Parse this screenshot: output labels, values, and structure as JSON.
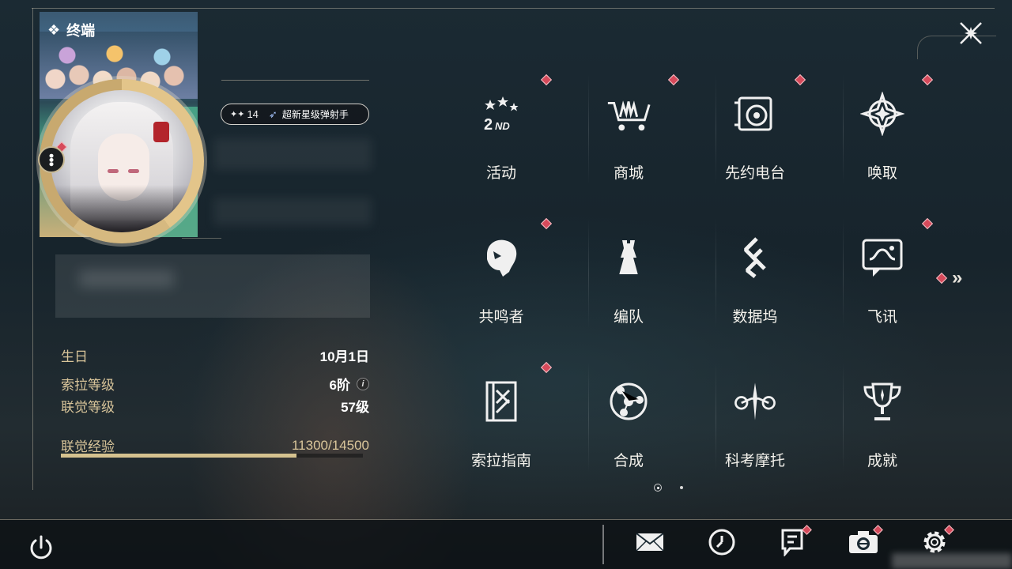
{
  "profile": {
    "banner_title": "终端",
    "rank": {
      "level": "14",
      "title": "超新星级弹射手"
    },
    "details": [
      {
        "label": "生日",
        "value": "10月1日"
      },
      {
        "label": "索拉等级",
        "value": "6阶",
        "has_info": true
      },
      {
        "label": "联觉等级",
        "value": "57级"
      }
    ],
    "experience": {
      "label": "联觉经验",
      "value_text": "11300/14500",
      "current": 11300,
      "max": 14500
    }
  },
  "menu": {
    "items": [
      {
        "label": "活动",
        "icon": "events-2nd-icon",
        "badge": true
      },
      {
        "label": "商城",
        "icon": "shop-cart-icon",
        "badge": true
      },
      {
        "label": "先约电台",
        "icon": "radio-icon",
        "badge": true
      },
      {
        "label": "唤取",
        "icon": "gacha-compass-icon",
        "badge": true
      },
      {
        "label": "共鸣者",
        "icon": "resonator-head-icon",
        "badge": true
      },
      {
        "label": "编队",
        "icon": "team-chess-icon",
        "badge": false
      },
      {
        "label": "数据坞",
        "icon": "data-bank-icon",
        "badge": false
      },
      {
        "label": "飞讯",
        "icon": "message-chat-icon",
        "badge": true
      },
      {
        "label": "索拉指南",
        "icon": "guidebook-icon",
        "badge": true
      },
      {
        "label": "合成",
        "icon": "synthesis-icon",
        "badge": false
      },
      {
        "label": "科考摩托",
        "icon": "motorcycle-icon",
        "badge": false
      },
      {
        "label": "成就",
        "icon": "trophy-icon",
        "badge": false
      }
    ],
    "page_current": 1,
    "page_count": 2
  },
  "bottom_bar": {
    "icons": [
      {
        "name": "mail-icon",
        "badge": false
      },
      {
        "name": "clock-icon",
        "badge": false
      },
      {
        "name": "notice-icon",
        "badge": true
      },
      {
        "name": "camera-icon",
        "badge": true
      },
      {
        "name": "settings-gear-icon",
        "badge": true
      }
    ]
  },
  "colors": {
    "accent_gold": "#d9c59a",
    "badge_red": "#d64a5b",
    "exp_fill": "#d5c28f"
  }
}
